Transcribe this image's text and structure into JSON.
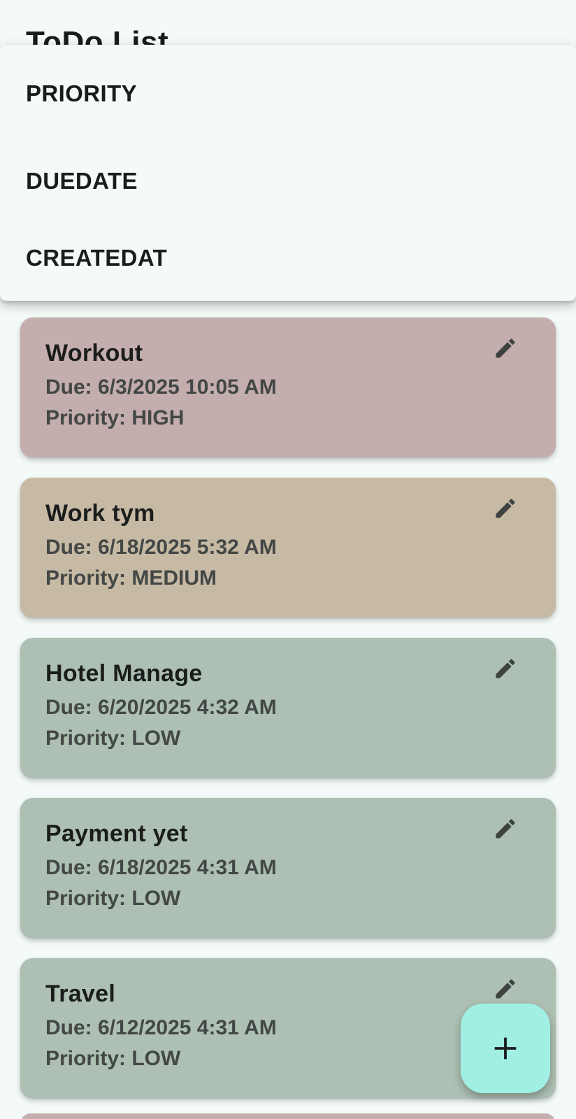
{
  "app": {
    "title": "ToDo List"
  },
  "sort_menu": {
    "items": [
      {
        "label": "PRIORITY"
      },
      {
        "label": "DUEDATE"
      },
      {
        "label": "CREATEDAT"
      }
    ]
  },
  "tasks": [
    {
      "title": "Workout",
      "due": "Due: 6/3/2025 10:05 AM",
      "priority": "Priority: HIGH",
      "color": "#c4adad"
    },
    {
      "title": "Work tym",
      "due": "Due: 6/18/2025 5:32 AM",
      "priority": "Priority: MEDIUM",
      "color": "#c7baa4"
    },
    {
      "title": "Hotel Manage",
      "due": "Due: 6/20/2025 4:32 AM",
      "priority": "Priority: LOW",
      "color": "#adc0b3"
    },
    {
      "title": "Payment yet",
      "due": "Due: 6/18/2025 4:31 AM",
      "priority": "Priority: LOW",
      "color": "#adc0b3"
    },
    {
      "title": "Travel",
      "due": "Due: 6/12/2025 4:31 AM",
      "priority": "Priority: LOW",
      "color": "#adc0b3"
    }
  ],
  "icons": {
    "edit": "pencil-icon",
    "add": "plus-icon"
  },
  "colors": {
    "background": "#f3faf7",
    "fab": "#a0efe2",
    "high": "#c4adad",
    "medium": "#c7baa4",
    "low": "#adc0b3"
  }
}
